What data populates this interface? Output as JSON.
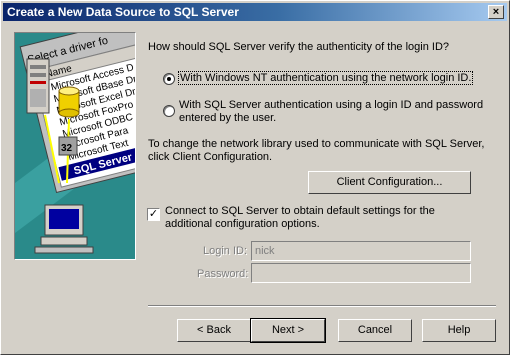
{
  "window": {
    "title": "Create a New Data Source to SQL Server",
    "close_glyph": "×"
  },
  "illustration": {
    "list_title": "Select a driver fo",
    "column_header": "Name",
    "drivers": [
      "Microsoft Access D",
      "Microsoft dBase Dr",
      "Microsoft Excel Dr",
      "Microsoft FoxPro",
      "Microsoft ODBC",
      "Microsoft Para",
      "Microsoft Text"
    ],
    "selected_driver": "SQL Server"
  },
  "auth": {
    "question": "How should SQL Server verify the authenticity of the login ID?",
    "option_nt": "With Windows NT authentication using the network login ID.",
    "option_sql_line1": "With SQL Server authentication using a login ID and password",
    "option_sql_line2": "entered by the user.",
    "selected": "nt"
  },
  "network": {
    "text_line1": "To change the network library used to communicate with SQL Server,",
    "text_line2": "click Client Configuration.",
    "client_config_label": "Client Configuration..."
  },
  "connect": {
    "checked": true,
    "label_line1": "Connect to SQL Server to obtain default settings for the",
    "label_line2": "additional configuration options."
  },
  "login": {
    "login_id_label": "Login ID:",
    "login_id_value": "nick",
    "password_label": "Password:",
    "password_value": ""
  },
  "buttons": {
    "back": "< Back",
    "next": "Next >",
    "cancel": "Cancel",
    "help": "Help"
  },
  "colors": {
    "titlebar_start": "#0a246a",
    "titlebar_end": "#a6caf0",
    "dialog_face": "#d4d0c8",
    "illustration_bg": "#2a8a8a"
  }
}
